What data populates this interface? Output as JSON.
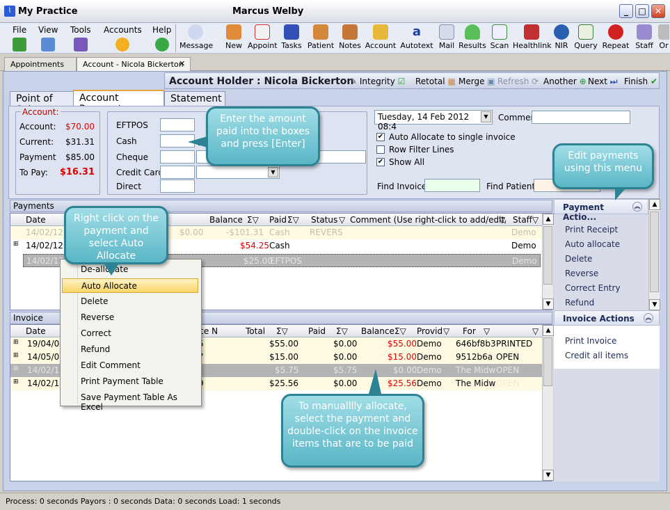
{
  "window": {
    "app_title": "My Practice",
    "user": "Marcus Welby",
    "minimize": "_",
    "maximize": "□",
    "close": "✕"
  },
  "menus": [
    "File",
    "View",
    "Tools",
    "Accounts",
    "Help"
  ],
  "toolbar": [
    "Message",
    "New",
    "Appoint",
    "Tasks",
    "Patient",
    "Notes",
    "Account",
    "Autotext",
    "Mail",
    "Results",
    "Scan",
    "Healthlink",
    "NIR",
    "Query",
    "Repeat",
    "Staff",
    "Or"
  ],
  "doc_tabs": [
    "Appointments",
    "Account - Nicola Bickerton"
  ],
  "header": {
    "holder_label": "Account Holder :",
    "holder_name": "Nicola Bickerton",
    "links": [
      "Integrity",
      "Retotal",
      "Merge",
      "Refresh",
      "Another",
      "Next",
      "Finish"
    ]
  },
  "subtabs": [
    "Point of Sale",
    "Account Payment",
    "Statement"
  ],
  "account": {
    "legend": "Account:",
    "rows": [
      {
        "label": "Account:",
        "value": "$70.00",
        "red": true
      },
      {
        "label": "Current:",
        "value": "$31.31",
        "red": false
      },
      {
        "label": "Payment",
        "value": "$85.00",
        "red": false
      },
      {
        "label": "To Pay:",
        "value": "$16.31",
        "red": true
      }
    ]
  },
  "payment_inputs": [
    "EFTPOS",
    "Cash",
    "Cheque",
    "Credit Card",
    "Direct"
  ],
  "bank_label": "Ba",
  "right_top": {
    "date": "Tuesday, 14 Feb 2012  08:4",
    "comment_label": "Comment",
    "checks": [
      {
        "label": "Auto Allocate to single invoice",
        "checked": true
      },
      {
        "label": "Row Filter Lines",
        "checked": false
      },
      {
        "label": "Show All",
        "checked": true
      }
    ],
    "find_invoice": "Find Invoice",
    "find_patient": "Find Patient"
  },
  "payments": {
    "title": "Payments",
    "cols": [
      "Date",
      "Balance",
      "Paid",
      "Status",
      "Comment  (Use right-click to add/edit/dele",
      "Staff"
    ],
    "rows": [
      {
        "date": "14/02/12",
        "amount": "$0.00",
        "balance": "-$101.31",
        "paid": "Cash",
        "status": "REVERS",
        "staff": "Demo"
      },
      {
        "date": "14/02/12",
        "amount": "",
        "balance": "$54.25",
        "paid": "Cash",
        "status": "",
        "staff": "Demo"
      },
      {
        "date": "14/02/12",
        "amount": "",
        "balance": "$25.00",
        "paid": "EFTPOS",
        "status": "",
        "staff": "Demo"
      }
    ]
  },
  "invoice": {
    "title": "Invoice",
    "cols": [
      "Date",
      "ice N",
      "Total",
      "Paid",
      "Balance",
      "Provid",
      "For",
      ""
    ],
    "rows": [
      {
        "date": "19/04/04",
        "no": "5",
        "total": "$55.00",
        "paid": "$0.00",
        "balance": "$55.00",
        "prov": "Demo",
        "for": "646bf8b3",
        "status": "PRINTED"
      },
      {
        "date": "14/05/04",
        "no": "7",
        "total": "$15.00",
        "paid": "$0.00",
        "balance": "$15.00",
        "prov": "Demo",
        "for": "9512b6a",
        "status": "OPEN"
      },
      {
        "date": "14/02/12",
        "no": "",
        "total": "$5.75",
        "paid": "$5.75",
        "balance": "$0.00",
        "prov": "Demo",
        "for": "The Midw",
        "status": "OPEN"
      },
      {
        "date": "14/02/12",
        "no": "9",
        "total": "$25.56",
        "paid": "$0.00",
        "balance": "$25.56",
        "prov": "Demo",
        "for": "The Midw",
        "status": "OPEN"
      }
    ]
  },
  "payment_actions": {
    "title": "Payment Actio...",
    "items": [
      "Print Receipt",
      "Auto allocate",
      "Delete",
      "Reverse",
      "Correct Entry",
      "Refund"
    ]
  },
  "invoice_actions": {
    "title": "Invoice Actions",
    "items": [
      "Print Invoice",
      "Credit all items"
    ]
  },
  "context_menu": [
    "De-allocate",
    "Auto Allocate",
    "Delete",
    "Reverse",
    "Correct",
    "Refund",
    "Edit Comment",
    "Print Payment Table",
    "Save Payment Table As Excel"
  ],
  "callouts": {
    "enter": "Enter the amount paid into the boxes and press [Enter]",
    "edit": "Edit payments using this menu",
    "right_click": "Right click on the payment and select Auto Allocate",
    "manual": "To manualllly allocate, select the payment and double-click on the invoice items that are to be paid"
  },
  "status": "Process: 0 seconds Payors : 0 seconds Data: 0 seconds Load: 1 seconds",
  "colors": {
    "accent": "#2d8394",
    "red": "#e00000",
    "selected_menu": "#f8d668"
  }
}
